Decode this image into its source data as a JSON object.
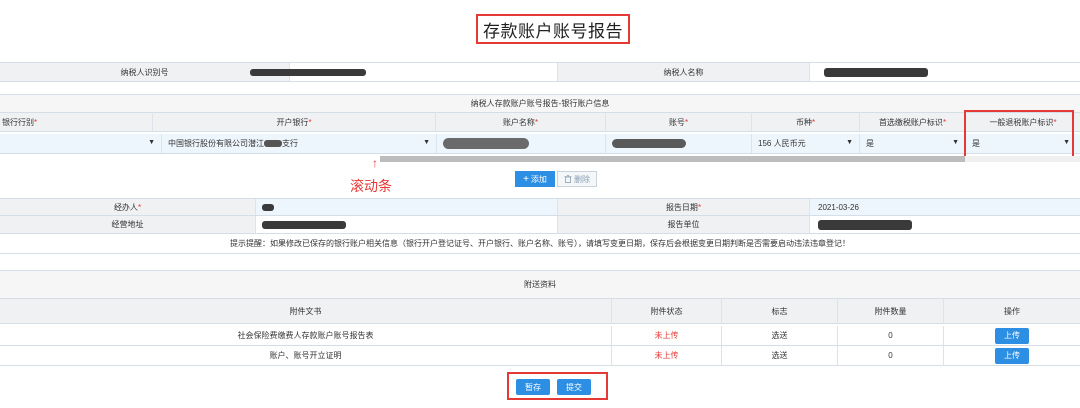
{
  "title": "存款账户账号报告",
  "taxpayer": {
    "id_label": "纳税人识别号",
    "name_label": "纳税人名称"
  },
  "bank": {
    "caption": "纳税人存款账户账号报告-银行账户信息",
    "columns": [
      {
        "label": "银行行别",
        "required": "*"
      },
      {
        "label": "开户银行",
        "required": "*"
      },
      {
        "label": "账户名称",
        "required": "*"
      },
      {
        "label": "账号",
        "required": "*"
      },
      {
        "label": "币种",
        "required": "*"
      },
      {
        "label": "首选缴税账户标识",
        "required": "*"
      },
      {
        "label": "一般退税账户标识",
        "required": "*"
      }
    ],
    "row": {
      "bank_type": "",
      "open_bank": "中国银行股份有限公司潜江",
      "open_bank_suffix": "支行",
      "currency": "156 人民币元",
      "preferred_tax": "是",
      "general_refund": "是"
    },
    "scroll_label": "滚动条",
    "arrow": "↑",
    "add_label": "添加",
    "delete_label": "删除",
    "icons": {
      "add": "plus-icon",
      "delete": "trash-icon",
      "caret": "caret-down-icon"
    }
  },
  "handler": {
    "agent_label": "经办人",
    "agent_req": "*",
    "date_label": "报告日期",
    "date_req": "*",
    "date_value": "2021-03-26",
    "address_label": "经营地址",
    "unit_label": "报告单位"
  },
  "hint": "提示提醒：如果修改已保存的银行账户相关信息（银行开户登记证号、开户银行、账户名称、账号），请填写变更日期，保存后会根据变更日期判断是否需要启动违法违章登记！",
  "attachments": {
    "caption": "附送资料",
    "headers": [
      "附件文书",
      "附件状态",
      "标志",
      "附件数量",
      "操作"
    ],
    "rows": [
      {
        "name": "社会保险费缴费人存款账户账号报告表",
        "status": "未上传",
        "flag": "选送",
        "count": "0",
        "action": "上传"
      },
      {
        "name": "账户、账号开立证明",
        "status": "未上传",
        "flag": "选送",
        "count": "0",
        "action": "上传"
      }
    ]
  },
  "actions": {
    "save": "暂存",
    "submit": "提交"
  },
  "colors": {
    "accent": "#2d8fe3",
    "alert": "#e53935"
  }
}
